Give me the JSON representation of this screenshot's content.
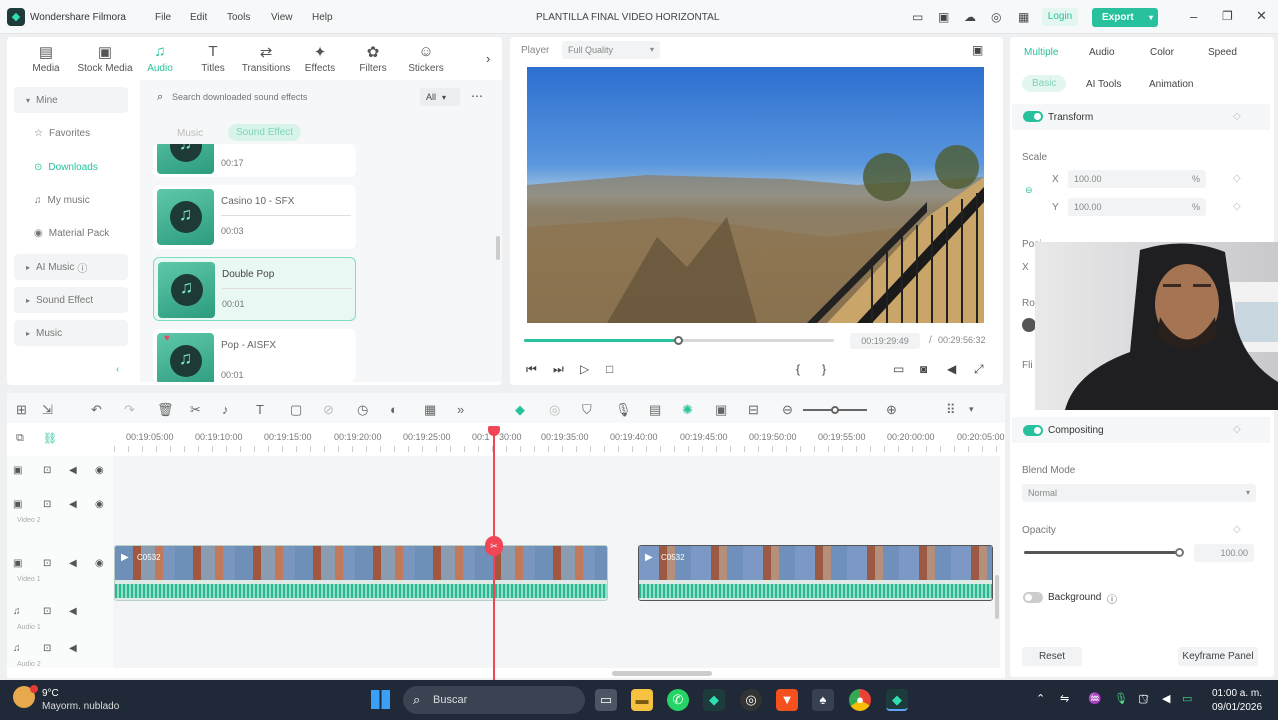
{
  "app": {
    "name": "Wondershare Filmora",
    "project": "PLANTILLA FINAL VIDEO HORIZONTAL",
    "login": "Login",
    "export": "Export"
  },
  "menu": [
    "File",
    "Edit",
    "Tools",
    "View",
    "Help"
  ],
  "tabs": [
    {
      "label": "Media",
      "icon": "media-icon"
    },
    {
      "label": "Stock Media",
      "icon": "stock-icon"
    },
    {
      "label": "Audio",
      "icon": "music-note-icon"
    },
    {
      "label": "Titles",
      "icon": "titles-icon"
    },
    {
      "label": "Transitions",
      "icon": "transitions-icon"
    },
    {
      "label": "Effects",
      "icon": "effects-icon"
    },
    {
      "label": "Filters",
      "icon": "filters-icon"
    },
    {
      "label": "Stickers",
      "icon": "stickers-icon"
    }
  ],
  "sidebar": {
    "mine": "Mine",
    "items": [
      "Favorites",
      "Downloads",
      "My music",
      "Material Pack"
    ],
    "groups": [
      "AI Music",
      "Sound Effect",
      "Music"
    ]
  },
  "library": {
    "search_placeholder": "Search downloaded sound effects",
    "filter": "All",
    "subtabs": [
      "Music",
      "Sound Effect"
    ],
    "items": [
      {
        "name": "",
        "duration": "00:17"
      },
      {
        "name": "Casino 10 - SFX",
        "duration": "00:03"
      },
      {
        "name": "Double Pop",
        "duration": "00:01"
      },
      {
        "name": "Pop - AISFX",
        "duration": "00:01"
      }
    ]
  },
  "player": {
    "label": "Player",
    "quality": "Full Quality",
    "current": "00:19:29:49",
    "total": "00:29:56:32",
    "progress": 0.5
  },
  "props": {
    "tabs": [
      "Multiple",
      "Audio",
      "Color",
      "Speed"
    ],
    "subtabs": [
      "Basic",
      "AI Tools",
      "Animation"
    ],
    "transform": "Transform",
    "scale": "Scale",
    "x": "X",
    "y": "Y",
    "scale_x": "100.00",
    "scale_y": "100.00",
    "position": "Posi",
    "rotate": "Ro",
    "flip": "Fli",
    "compositing": "Compositing",
    "blend_mode": "Blend Mode",
    "blend_value": "Normal",
    "opacity": "Opacity",
    "opacity_value": "100.00",
    "background": "Background",
    "reset": "Reset",
    "keyframe": "Keyframe Panel"
  },
  "timeline": {
    "ticks": [
      "00:19:05:00",
      "00:19:10:00",
      "00:19:15:00",
      "00:19:20:00",
      "00:19:25:00",
      "00:1",
      "30:00",
      "00:19:35:00",
      "00:19:40:00",
      "00:19:45:00",
      "00:19:50:00",
      "00:19:55:00",
      "00:20:00:00",
      "00:20:05:00"
    ],
    "clip1": "C0532",
    "clip2": "C0532",
    "track_labels": [
      "Video 2",
      "Video 1",
      "Audio 1",
      "Audio 2"
    ]
  },
  "taskbar": {
    "temp": "9°C",
    "weather": "Mayorm. nublado",
    "search": "Buscar",
    "time": "01:00 a. m.",
    "date": "09/01/2026"
  }
}
